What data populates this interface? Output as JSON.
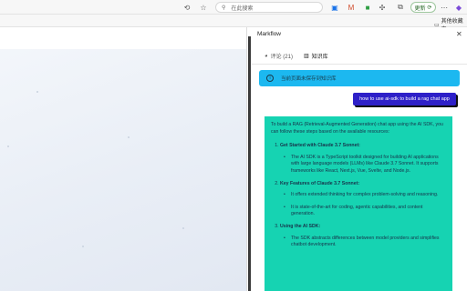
{
  "browser": {
    "search_placeholder": "在此搜索",
    "update_label": "更新",
    "favorites_label": "其他收藏夹"
  },
  "panel": {
    "title": "Markflow",
    "tabs": [
      {
        "label": "评论 (21)"
      },
      {
        "label": "知识库"
      }
    ],
    "notice": "当前页面未保存到知识库",
    "question": "how to use ai-sdk to build a rag chat app",
    "answer": {
      "intro": "To build a RAG (Retrieval-Augmented Generation) chat app using the AI SDK, you can follow these steps based on the available resources:",
      "sections": [
        {
          "heading": "Get Started with Claude 3.7 Sonnet:",
          "bullets": [
            "The AI SDK is a TypeScript toolkit designed for building AI applications with large language models (LLMs) like Claude 3.7 Sonnet. It supports frameworks like React, Next.js, Vue, Svelte, and Node.js."
          ]
        },
        {
          "heading": "Key Features of Claude 3.7 Sonnet:",
          "bullets": [
            "It offers extended thinking for complex problem-solving and reasoning.",
            "It is state-of-the-art for coding, agentic capabilities, and content generation."
          ]
        },
        {
          "heading": "Using the AI SDK:",
          "bullets": [
            "The SDK abstracts differences between model providers and simplifies chatbot development."
          ]
        }
      ]
    }
  }
}
